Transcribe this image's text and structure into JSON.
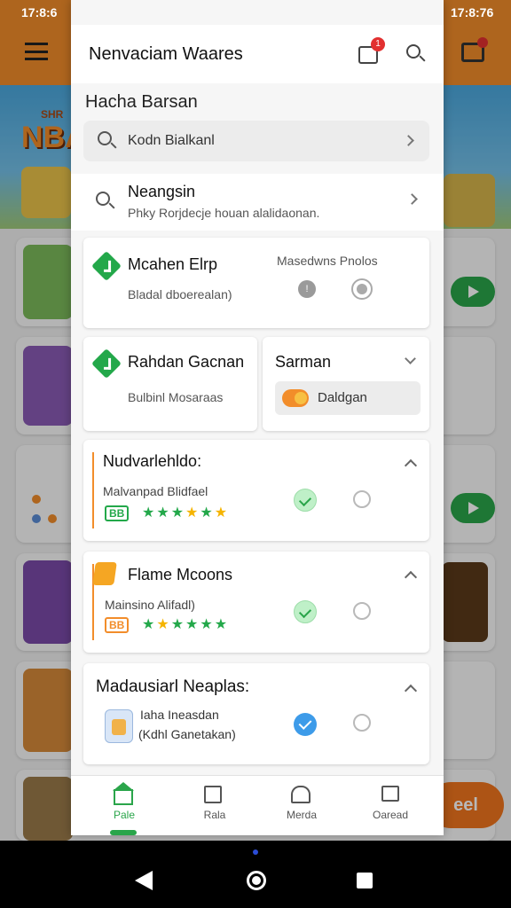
{
  "status_bar": {
    "time_left": "17:8:6",
    "time_right": "17:8:76"
  },
  "background": {
    "banner_text_top": "SHR",
    "banner_text_main": "NBA",
    "side_button_label": "eel"
  },
  "header": {
    "title": "Nenvaciam Waares",
    "notification_count": "1"
  },
  "section_title": "Hacha Barsan",
  "search": {
    "text": "Kodn Bialkanl"
  },
  "result": {
    "title": "Neangsin",
    "subtitle": "Phky Rorjdecje houan alalidaonan."
  },
  "option_primary": {
    "title": "Mcahen Elrp",
    "subtitle": "Bladal dboerealan)",
    "right_label": "Masedwns Pnolos"
  },
  "option_left": {
    "title": "Rahdan Gacnan",
    "subtitle": "Bulbinl Mosaraas"
  },
  "option_right": {
    "title": "Sarman",
    "chip_label": "Daldgan"
  },
  "group1": {
    "title": "Nudvarlehldo:",
    "subtitle": "Malvanpad Blidfael",
    "badge": "BB"
  },
  "group2": {
    "title": "Flame Mcoons",
    "subtitle": "Mainsino Alifadl)",
    "badge": "BB"
  },
  "group3": {
    "title": "Madausiarl Neaplas:",
    "item_title": "Iaha Ineasdan",
    "item_subtitle": "(Kdhl Ganetakan)"
  },
  "tabs": [
    {
      "label": "Pale",
      "icon": "home-icon"
    },
    {
      "label": "Rala",
      "icon": "edit-icon"
    },
    {
      "label": "Merda",
      "icon": "people-icon"
    },
    {
      "label": "Oaread",
      "icon": "inbox-icon"
    }
  ],
  "colors": {
    "accent": "#f28d2a",
    "green": "#23a84a",
    "blue": "#3d9be9",
    "star_gold": "#f5b400"
  }
}
